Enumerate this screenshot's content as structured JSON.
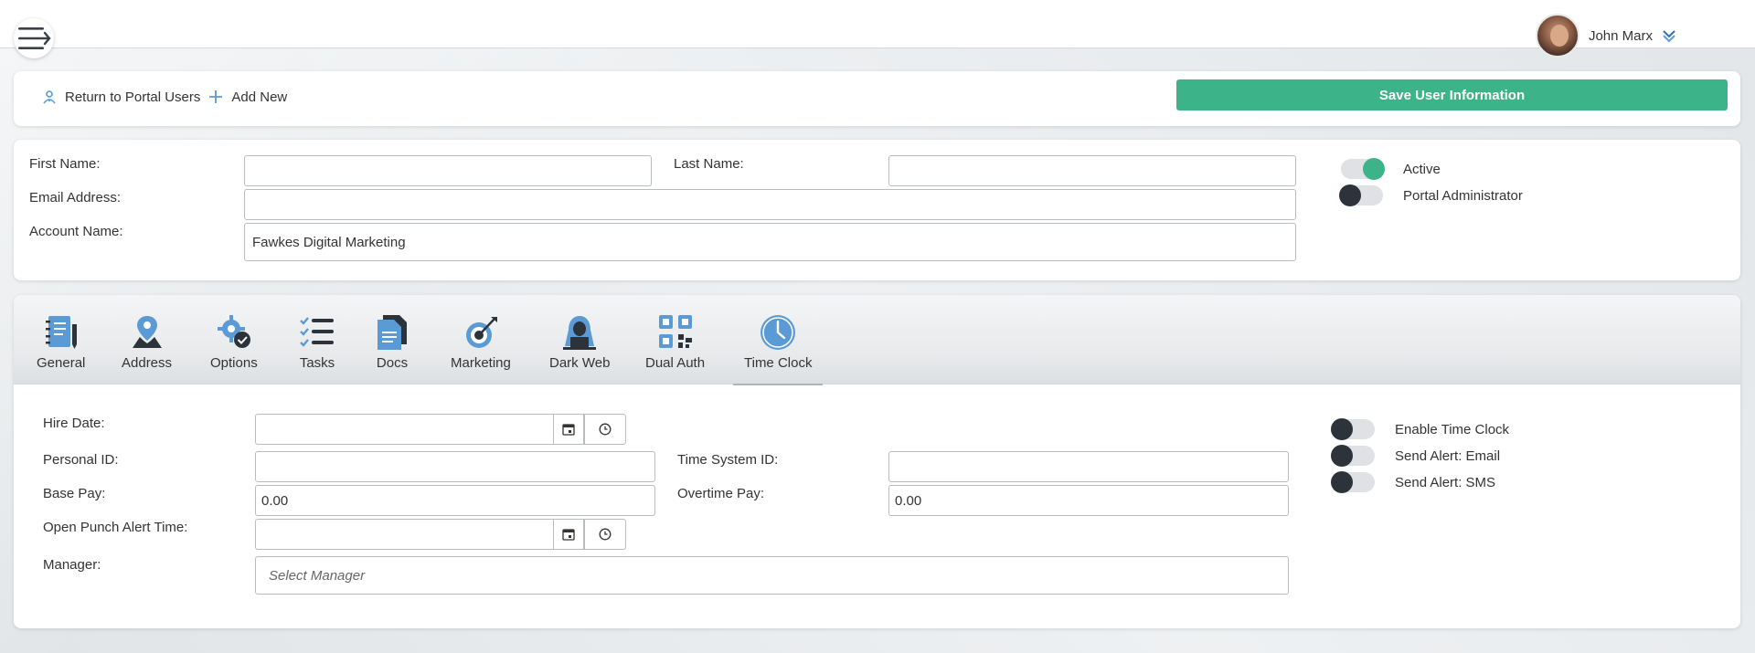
{
  "header": {
    "user_name": "John Marx"
  },
  "toolbar": {
    "return_label": "Return to Portal Users",
    "add_new_label": "Add New",
    "save_label": "Save User Information"
  },
  "user_form": {
    "first_name_label": "First Name:",
    "first_name_value": "",
    "last_name_label": "Last Name:",
    "last_name_value": "",
    "email_label": "Email Address:",
    "email_value": "",
    "account_label": "Account Name:",
    "account_value": "Fawkes Digital Marketing",
    "toggles": [
      {
        "label": "Active",
        "on": true
      },
      {
        "label": "Portal Administrator",
        "on": false
      }
    ]
  },
  "tabs": [
    {
      "label": "General",
      "icon": "notebook-icon"
    },
    {
      "label": "Address",
      "icon": "map-pin-icon"
    },
    {
      "label": "Options",
      "icon": "gear-check-icon"
    },
    {
      "label": "Tasks",
      "icon": "checklist-icon"
    },
    {
      "label": "Docs",
      "icon": "documents-icon"
    },
    {
      "label": "Marketing",
      "icon": "target-icon"
    },
    {
      "label": "Dark Web",
      "icon": "hacker-icon"
    },
    {
      "label": "Dual Auth",
      "icon": "qr-code-icon"
    },
    {
      "label": "Time Clock",
      "icon": "clock-icon",
      "active": true
    }
  ],
  "time_clock": {
    "hire_date_label": "Hire Date:",
    "hire_date_value": "",
    "personal_id_label": "Personal ID:",
    "personal_id_value": "",
    "time_system_id_label": "Time System ID:",
    "time_system_id_value": "",
    "base_pay_label": "Base Pay:",
    "base_pay_value": "0.00",
    "overtime_pay_label": "Overtime Pay:",
    "overtime_pay_value": "0.00",
    "open_punch_label": "Open Punch Alert Time:",
    "open_punch_value": "",
    "manager_label": "Manager:",
    "manager_placeholder": "Select Manager",
    "toggles": [
      {
        "label": "Enable Time Clock",
        "on": false
      },
      {
        "label": "Send Alert: Email",
        "on": false
      },
      {
        "label": "Send Alert: SMS",
        "on": false
      }
    ]
  },
  "colors": {
    "accent": "#3db389",
    "icon_blue": "#5b9bd5",
    "icon_dark": "#2d333a"
  }
}
